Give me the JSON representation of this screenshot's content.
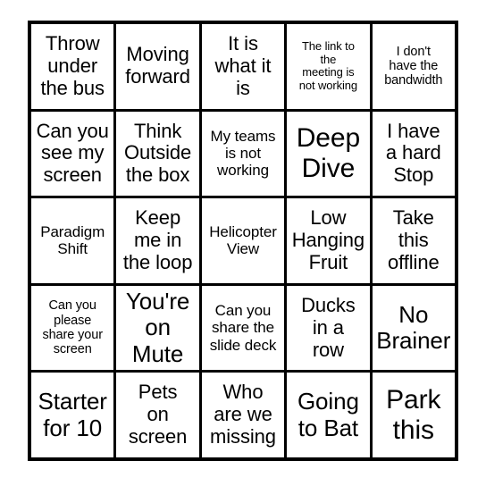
{
  "card": {
    "name": "meeting-buzzword-bingo-card",
    "rows": 5,
    "columns": 5,
    "border_color": "#000000",
    "cell_background": "#ffffff",
    "text_color": "#000000",
    "cells": [
      {
        "text": "Throw\nunder\nthe bus",
        "size": "l"
      },
      {
        "text": "Moving\nforward",
        "size": "l"
      },
      {
        "text": "It is\nwhat it\nis",
        "size": "l"
      },
      {
        "text": "The link to\nthe\nmeeting is\nnot working",
        "size": "xxs"
      },
      {
        "text": "I don't\nhave the\nbandwidth",
        "size": "xs"
      },
      {
        "text": "Can you\nsee my\nscreen",
        "size": "l"
      },
      {
        "text": "Think\nOutside\nthe box",
        "size": "l"
      },
      {
        "text": "My teams\nis not\nworking",
        "size": "s"
      },
      {
        "text": "Deep\nDive",
        "size": "xxl"
      },
      {
        "text": "I have\na hard\nStop",
        "size": "l"
      },
      {
        "text": "Paradigm\nShift",
        "size": "s"
      },
      {
        "text": "Keep\nme in\nthe loop",
        "size": "l"
      },
      {
        "text": "Helicopter\nView",
        "size": "s"
      },
      {
        "text": "Low\nHanging\nFruit",
        "size": "l"
      },
      {
        "text": "Take\nthis\noffline",
        "size": "l"
      },
      {
        "text": "Can you\nplease\nshare your\nscreen",
        "size": "xs"
      },
      {
        "text": "You're\non\nMute",
        "size": "xl"
      },
      {
        "text": "Can you\nshare the\nslide deck",
        "size": "s"
      },
      {
        "text": "Ducks\nin a\nrow",
        "size": "l"
      },
      {
        "text": "No\nBrainer",
        "size": "xl"
      },
      {
        "text": "Starter\nfor 10",
        "size": "xl"
      },
      {
        "text": "Pets\non\nscreen",
        "size": "l"
      },
      {
        "text": "Who\nare we\nmissing",
        "size": "l"
      },
      {
        "text": "Going\nto Bat",
        "size": "xl"
      },
      {
        "text": "Park\nthis",
        "size": "xxl"
      }
    ]
  }
}
